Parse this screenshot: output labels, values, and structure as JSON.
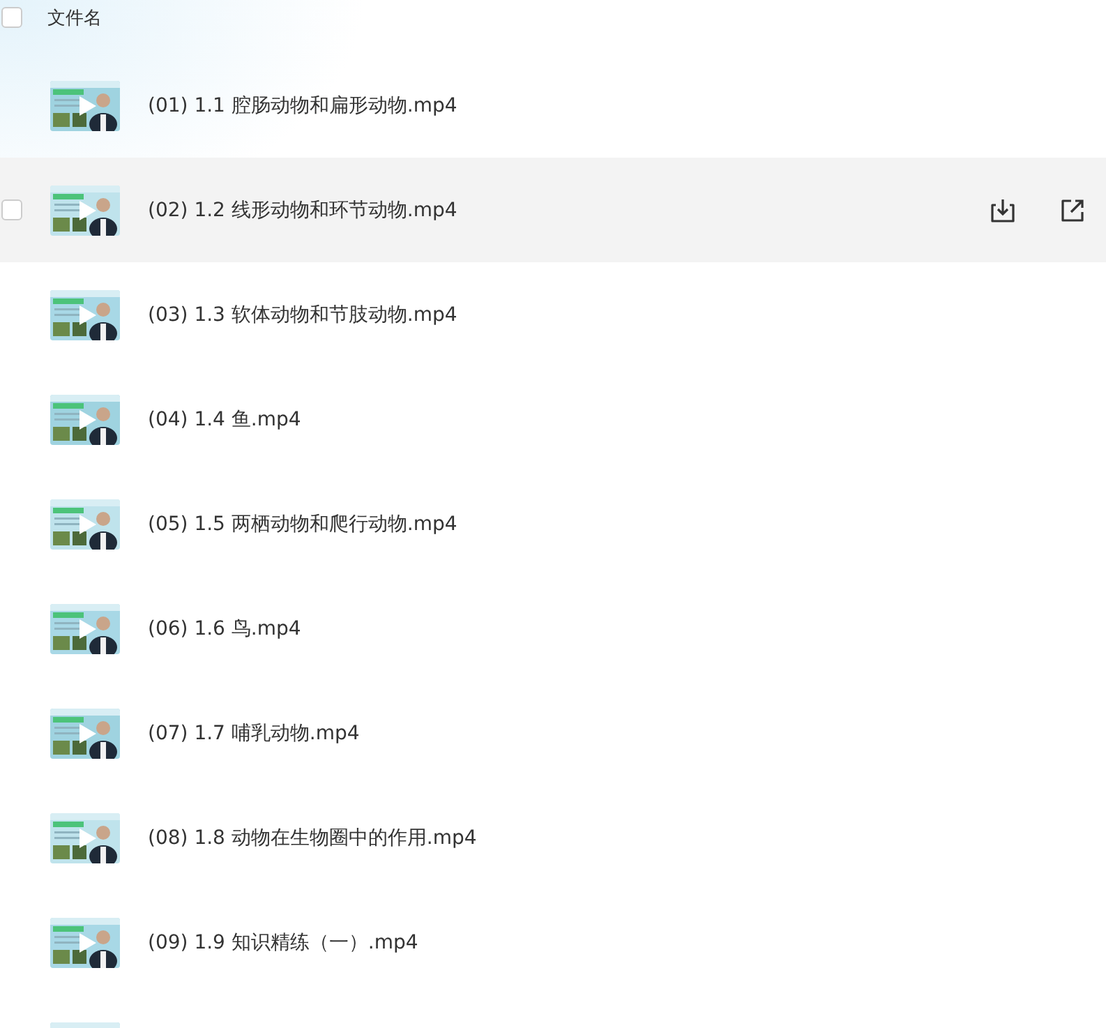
{
  "header": {
    "label": "文件名",
    "checked": false
  },
  "files": [
    {
      "name": "(01) 1.1 腔肠动物和扁形动物.mp4",
      "hovered": false
    },
    {
      "name": "(02) 1.2 线形动物和环节动物.mp4",
      "hovered": true
    },
    {
      "name": "(03) 1.3 软体动物和节肢动物.mp4",
      "hovered": false
    },
    {
      "name": "(04) 1.4 鱼.mp4",
      "hovered": false
    },
    {
      "name": "(05) 1.5 两栖动物和爬行动物.mp4",
      "hovered": false
    },
    {
      "name": "(06) 1.6 鸟.mp4",
      "hovered": false
    },
    {
      "name": "(07) 1.7 哺乳动物.mp4",
      "hovered": false
    },
    {
      "name": "(08) 1.8 动物在生物圈中的作用.mp4",
      "hovered": false
    },
    {
      "name": "(09) 1.9  知识精练（一）.mp4",
      "hovered": false
    },
    {
      "hovered": false
    }
  ]
}
